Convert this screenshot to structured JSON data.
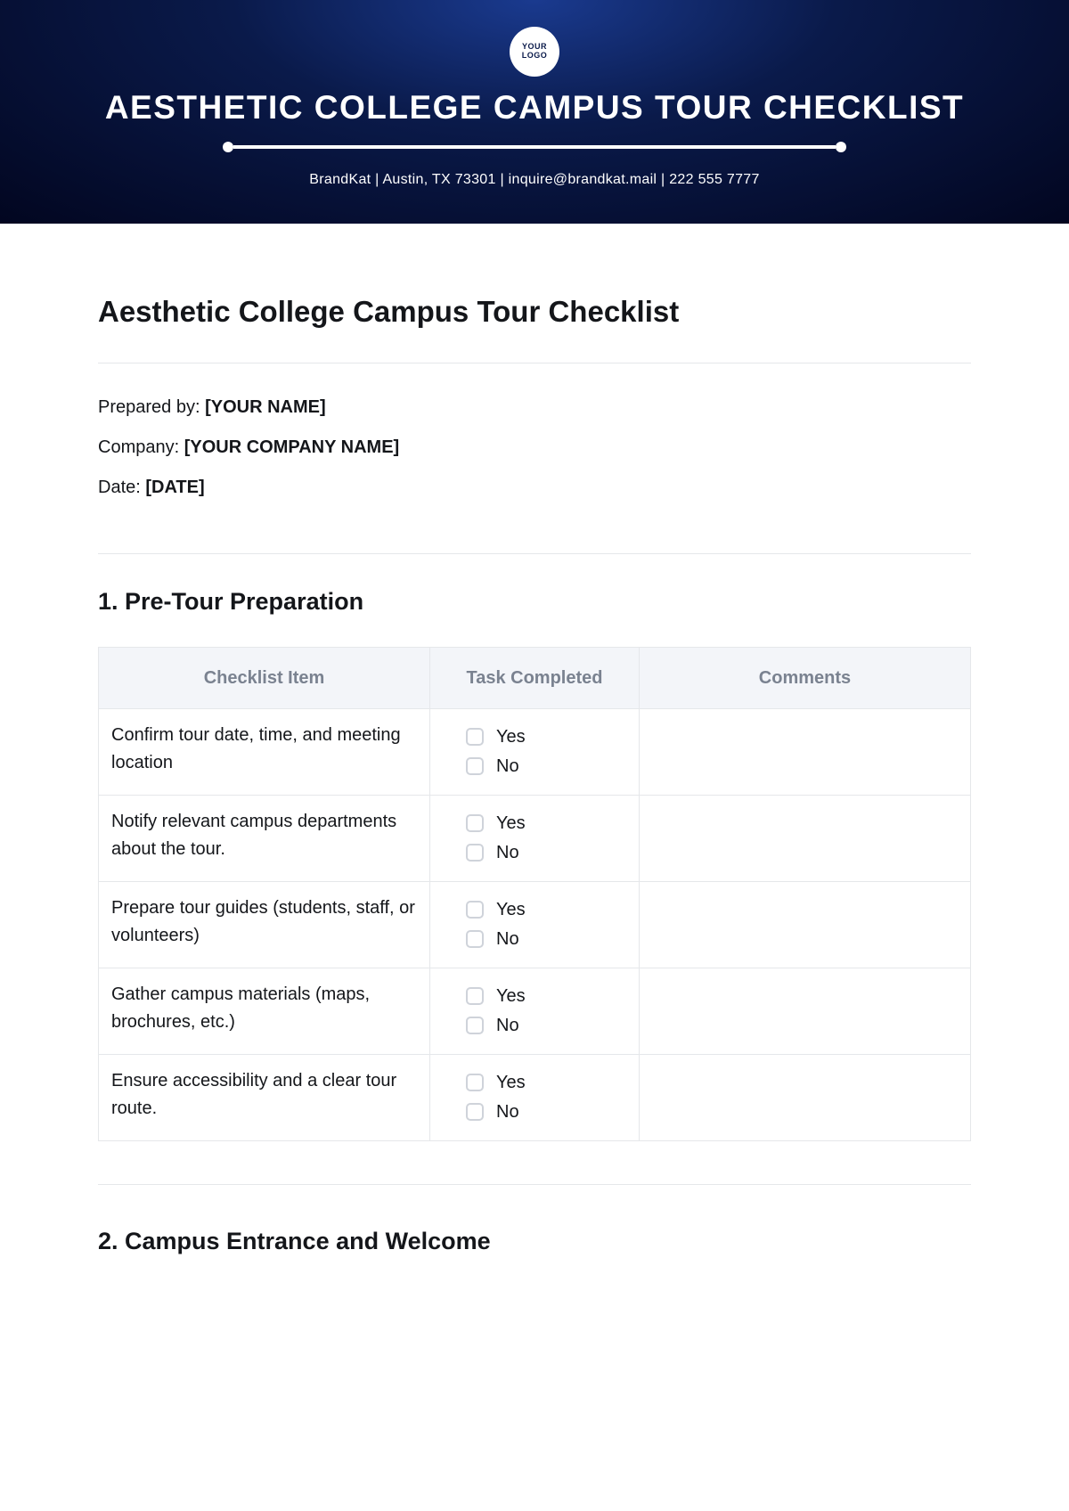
{
  "header": {
    "logo_text": "YOUR\nLOGO",
    "title": "AESTHETIC COLLEGE CAMPUS TOUR CHECKLIST",
    "contact": "BrandKat | Austin, TX 73301 | inquire@brandkat.mail |  222 555 7777"
  },
  "document": {
    "title": "Aesthetic College Campus Tour Checklist",
    "fields": {
      "prepared_by_label": "Prepared by: ",
      "prepared_by_value": "[YOUR NAME]",
      "company_label": "Company: ",
      "company_value": "[YOUR COMPANY NAME]",
      "date_label": "Date: ",
      "date_value": "[DATE]"
    }
  },
  "table_headers": {
    "item": "Checklist Item",
    "task": "Task Completed",
    "comments": "Comments"
  },
  "options": {
    "yes": "Yes",
    "no": "No"
  },
  "sections": [
    {
      "title": "1. Pre-Tour Preparation",
      "items": [
        "Confirm tour date, time, and meeting location",
        "Notify relevant campus departments about the tour.",
        "Prepare tour guides (students, staff, or volunteers)",
        "Gather campus materials (maps, brochures, etc.)",
        "Ensure accessibility and a clear tour route."
      ]
    },
    {
      "title": "2. Campus Entrance and Welcome",
      "items": []
    }
  ]
}
